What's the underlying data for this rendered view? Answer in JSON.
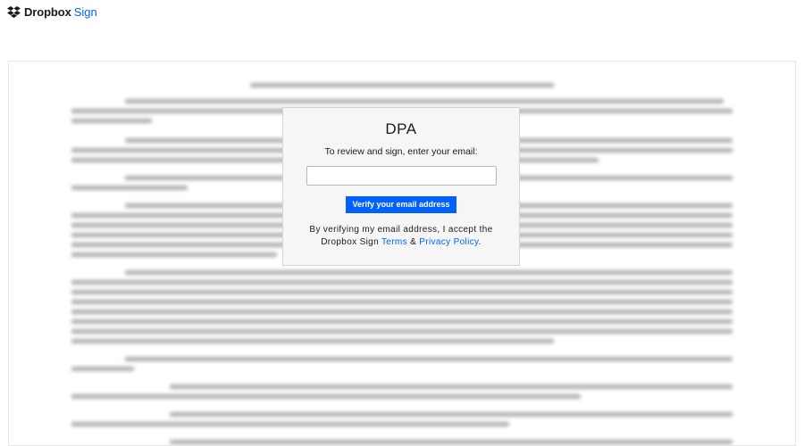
{
  "brand": {
    "name": "Dropbox",
    "product": "Sign",
    "accent_color": "#0061fe"
  },
  "modal": {
    "title": "DPA",
    "prompt": "To review and sign, enter your email:",
    "email_value": "",
    "button_label": "Verify your email address",
    "consent_prefix": "By verifying my email address, I accept the Dropbox Sign",
    "terms_label": "Terms",
    "and_text": "&",
    "privacy_label": "Privacy Policy",
    "consent_suffix": "."
  }
}
